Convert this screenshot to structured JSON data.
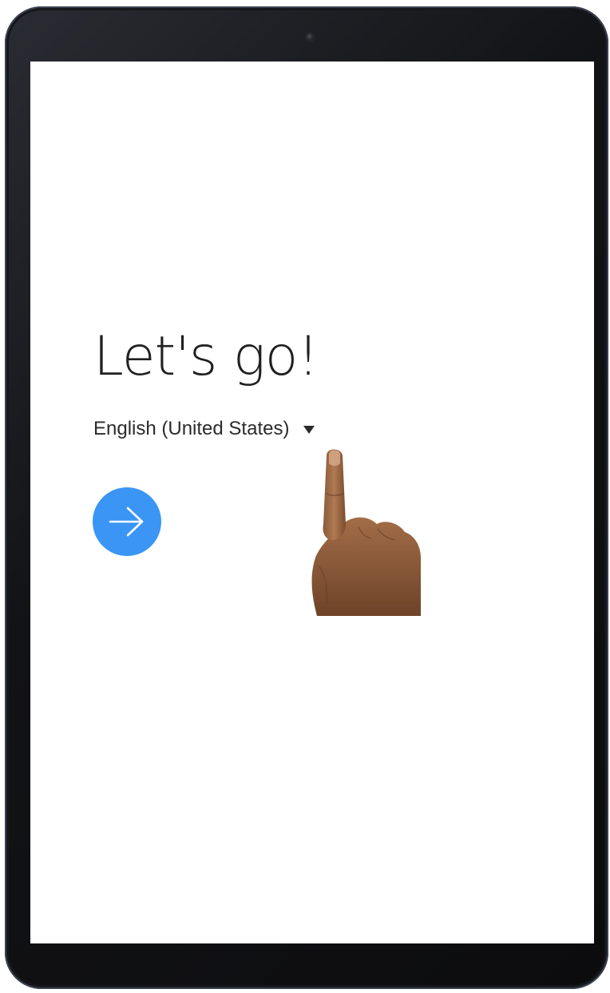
{
  "setup": {
    "title": "Let's go!",
    "language_selected": "English (United States)",
    "language_dropdown_icon": "caret-down-icon",
    "next_icon": "arrow-right-icon"
  },
  "colors": {
    "accent": "#3a95f5",
    "screen_background": "#ffffff",
    "device_frame": "#111214"
  }
}
